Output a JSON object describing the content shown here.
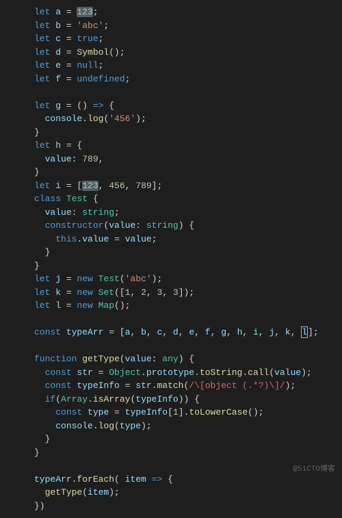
{
  "watermark": "@51CTO博客",
  "lines": [
    [
      [
        "kw",
        "let"
      ],
      [
        "",
        ""
      ],
      [
        "var",
        " a "
      ],
      [
        "op",
        "= "
      ],
      [
        "num hl",
        "123"
      ],
      [
        "punc",
        ";"
      ]
    ],
    [
      [
        "kw",
        "let"
      ],
      [
        "var",
        " b "
      ],
      [
        "op",
        "= "
      ],
      [
        "str",
        "'abc'"
      ],
      [
        "punc",
        ";"
      ]
    ],
    [
      [
        "kw",
        "let"
      ],
      [
        "var",
        " c "
      ],
      [
        "op",
        "= "
      ],
      [
        "bool",
        "true"
      ],
      [
        "punc",
        ";"
      ]
    ],
    [
      [
        "kw",
        "let"
      ],
      [
        "var",
        " d "
      ],
      [
        "op",
        "= "
      ],
      [
        "fn",
        "Symbol"
      ],
      [
        "punc",
        "();"
      ]
    ],
    [
      [
        "kw",
        "let"
      ],
      [
        "var",
        " e "
      ],
      [
        "op",
        "= "
      ],
      [
        "bool",
        "null"
      ],
      [
        "punc",
        ";"
      ]
    ],
    [
      [
        "kw",
        "let"
      ],
      [
        "var",
        " f "
      ],
      [
        "op",
        "= "
      ],
      [
        "bool",
        "undefined"
      ],
      [
        "punc",
        ";"
      ]
    ],
    [],
    [
      [
        "kw",
        "let"
      ],
      [
        "var",
        " g "
      ],
      [
        "op",
        "= "
      ],
      [
        "punc",
        "() "
      ],
      [
        "kw",
        "=>"
      ],
      [
        "punc",
        " {"
      ]
    ],
    [
      [
        "",
        "  "
      ],
      [
        "prop",
        "console"
      ],
      [
        "punc",
        "."
      ],
      [
        "fn",
        "log"
      ],
      [
        "punc",
        "("
      ],
      [
        "str",
        "'456'"
      ],
      [
        "punc",
        ");"
      ]
    ],
    [
      [
        "punc",
        "}"
      ]
    ],
    [
      [
        "kw",
        "let"
      ],
      [
        "var",
        " h "
      ],
      [
        "op",
        "= "
      ],
      [
        "punc",
        "{"
      ]
    ],
    [
      [
        "",
        "  "
      ],
      [
        "prop",
        "value"
      ],
      [
        "punc",
        ": "
      ],
      [
        "num",
        "789"
      ],
      [
        "punc",
        ","
      ]
    ],
    [
      [
        "punc",
        "}"
      ]
    ],
    [
      [
        "kw",
        "let"
      ],
      [
        "var",
        " i "
      ],
      [
        "op",
        "= "
      ],
      [
        "punc",
        "["
      ],
      [
        "num hl",
        "123"
      ],
      [
        "punc",
        ", "
      ],
      [
        "num",
        "456"
      ],
      [
        "punc",
        ", "
      ],
      [
        "num",
        "789"
      ],
      [
        "punc",
        "];"
      ]
    ],
    [
      [
        "kw",
        "class"
      ],
      [
        "cls",
        " Test "
      ],
      [
        "punc",
        "{"
      ]
    ],
    [
      [
        "",
        "  "
      ],
      [
        "prop",
        "value"
      ],
      [
        "punc",
        ": "
      ],
      [
        "type",
        "string"
      ],
      [
        "punc",
        ";"
      ]
    ],
    [
      [
        "",
        "  "
      ],
      [
        "kw",
        "constructor"
      ],
      [
        "punc",
        "("
      ],
      [
        "var",
        "value"
      ],
      [
        "punc",
        ": "
      ],
      [
        "type",
        "string"
      ],
      [
        "punc",
        ") {"
      ]
    ],
    [
      [
        "",
        "    "
      ],
      [
        "kw",
        "this"
      ],
      [
        "punc",
        "."
      ],
      [
        "prop",
        "value"
      ],
      [
        "punc",
        " = "
      ],
      [
        "var",
        "value"
      ],
      [
        "punc",
        ";"
      ]
    ],
    [
      [
        "",
        "  "
      ],
      [
        "punc",
        "}"
      ]
    ],
    [
      [
        "punc",
        "}"
      ]
    ],
    [
      [
        "kw",
        "let"
      ],
      [
        "var",
        " j "
      ],
      [
        "op",
        "= "
      ],
      [
        "kw",
        "new"
      ],
      [
        "cls",
        " Test"
      ],
      [
        "punc",
        "("
      ],
      [
        "str",
        "'abc'"
      ],
      [
        "punc",
        ");"
      ]
    ],
    [
      [
        "kw",
        "let"
      ],
      [
        "var",
        " k "
      ],
      [
        "op",
        "= "
      ],
      [
        "kw",
        "new"
      ],
      [
        "cls",
        " Set"
      ],
      [
        "punc",
        "(["
      ],
      [
        "num",
        "1"
      ],
      [
        "punc",
        ", "
      ],
      [
        "num",
        "2"
      ],
      [
        "punc",
        ", "
      ],
      [
        "num",
        "3"
      ],
      [
        "punc",
        ", "
      ],
      [
        "num",
        "3"
      ],
      [
        "punc",
        "]);"
      ]
    ],
    [
      [
        "kw",
        "let"
      ],
      [
        "var",
        " l "
      ],
      [
        "op",
        "= "
      ],
      [
        "kw",
        "new"
      ],
      [
        "cls",
        " Map"
      ],
      [
        "punc",
        "();"
      ]
    ],
    [],
    [
      [
        "kw",
        "const"
      ],
      [
        "var",
        " typeArr "
      ],
      [
        "op",
        "= "
      ],
      [
        "punc",
        "["
      ],
      [
        "var",
        "a"
      ],
      [
        "punc",
        ", "
      ],
      [
        "var",
        "b"
      ],
      [
        "punc",
        ", "
      ],
      [
        "var",
        "c"
      ],
      [
        "punc",
        ", "
      ],
      [
        "var",
        "d"
      ],
      [
        "punc",
        ", "
      ],
      [
        "var",
        "e"
      ],
      [
        "punc",
        ", "
      ],
      [
        "var",
        "f"
      ],
      [
        "punc",
        ", "
      ],
      [
        "var",
        "g"
      ],
      [
        "punc",
        ", "
      ],
      [
        "var",
        "h"
      ],
      [
        "punc",
        ", "
      ],
      [
        "var",
        "i"
      ],
      [
        "punc",
        ", "
      ],
      [
        "var",
        "j"
      ],
      [
        "punc",
        ", "
      ],
      [
        "var",
        "k"
      ],
      [
        "punc",
        ", "
      ],
      [
        "var cursor",
        "l"
      ],
      [
        "punc",
        "];"
      ]
    ],
    [],
    [
      [
        "kw",
        "function"
      ],
      [
        "fn",
        " getType"
      ],
      [
        "punc",
        "("
      ],
      [
        "var",
        "value"
      ],
      [
        "punc",
        ": "
      ],
      [
        "type",
        "any"
      ],
      [
        "punc",
        ") {"
      ]
    ],
    [
      [
        "",
        "  "
      ],
      [
        "kw",
        "const"
      ],
      [
        "var",
        " str "
      ],
      [
        "op",
        "= "
      ],
      [
        "cls",
        "Object"
      ],
      [
        "punc",
        "."
      ],
      [
        "prop",
        "prototype"
      ],
      [
        "punc",
        "."
      ],
      [
        "fn",
        "toString"
      ],
      [
        "punc",
        "."
      ],
      [
        "fn",
        "call"
      ],
      [
        "punc",
        "("
      ],
      [
        "var",
        "value"
      ],
      [
        "punc",
        ");"
      ]
    ],
    [
      [
        "",
        "  "
      ],
      [
        "kw",
        "const"
      ],
      [
        "var",
        " typeInfo "
      ],
      [
        "op",
        "= "
      ],
      [
        "var",
        "str"
      ],
      [
        "punc",
        "."
      ],
      [
        "fn",
        "match"
      ],
      [
        "punc",
        "("
      ],
      [
        "regex",
        "/\\[object (.*?)\\]/"
      ],
      [
        "punc",
        ");"
      ]
    ],
    [
      [
        "",
        "  "
      ],
      [
        "kw",
        "if"
      ],
      [
        "punc",
        "("
      ],
      [
        "cls",
        "Array"
      ],
      [
        "punc",
        "."
      ],
      [
        "fn",
        "isArray"
      ],
      [
        "punc",
        "("
      ],
      [
        "var",
        "typeInfo"
      ],
      [
        "punc",
        ")) {"
      ]
    ],
    [
      [
        "",
        "    "
      ],
      [
        "kw",
        "const"
      ],
      [
        "var",
        " type "
      ],
      [
        "op",
        "= "
      ],
      [
        "var",
        "typeInfo"
      ],
      [
        "punc",
        "["
      ],
      [
        "num",
        "1"
      ],
      [
        "punc",
        "]."
      ],
      [
        "fn",
        "toLowerCase"
      ],
      [
        "punc",
        "();"
      ]
    ],
    [
      [
        "",
        "    "
      ],
      [
        "prop",
        "console"
      ],
      [
        "punc",
        "."
      ],
      [
        "fn",
        "log"
      ],
      [
        "punc",
        "("
      ],
      [
        "var",
        "type"
      ],
      [
        "punc",
        ");"
      ]
    ],
    [
      [
        "",
        "  "
      ],
      [
        "punc",
        "}"
      ]
    ],
    [
      [
        "punc",
        "}"
      ]
    ],
    [],
    [
      [
        "var",
        "typeArr"
      ],
      [
        "punc",
        "."
      ],
      [
        "fn",
        "forEach"
      ],
      [
        "punc",
        "( "
      ],
      [
        "var",
        "item"
      ],
      [
        "punc",
        " "
      ],
      [
        "kw",
        "=>"
      ],
      [
        "punc",
        " {"
      ]
    ],
    [
      [
        "",
        "  "
      ],
      [
        "fn",
        "getType"
      ],
      [
        "punc",
        "("
      ],
      [
        "var",
        "item"
      ],
      [
        "punc",
        ");"
      ]
    ],
    [
      [
        "punc",
        "})"
      ]
    ]
  ]
}
